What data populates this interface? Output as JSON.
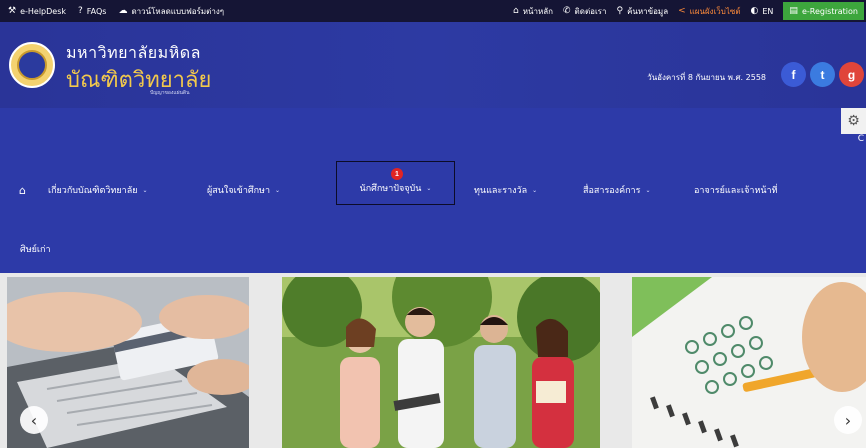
{
  "topbar": {
    "left": [
      {
        "icon": "helpdesk-icon",
        "glyph": "⚒",
        "label": "e-HelpDesk"
      },
      {
        "icon": "question-icon",
        "glyph": "?",
        "label": "FAQs"
      },
      {
        "icon": "cloud-download-icon",
        "glyph": "☁",
        "label": "ดาวน์โหลดแบบฟอร์มต่างๆ"
      }
    ],
    "right": [
      {
        "icon": "home-icon",
        "glyph": "⌂",
        "label": "หน้าหลัก"
      },
      {
        "icon": "phone-icon",
        "glyph": "✆",
        "label": "ติดต่อเรา"
      },
      {
        "icon": "search-icon",
        "glyph": "⚲",
        "label": "ค้นหาข้อมูล"
      },
      {
        "icon": "share-icon",
        "glyph": "<",
        "label": "แผนผังเว็บไซต์"
      },
      {
        "icon": "language-toggle-icon",
        "glyph": "◐",
        "label": "EN"
      }
    ],
    "register": {
      "icon": "register-icon",
      "glyph": "▤",
      "label": "e-Registration"
    }
  },
  "header": {
    "university_name": "มหาวิทยาลัยมหิดล",
    "graduate_name": "บัณฑิตวิทยาลัย",
    "motto": "ปัญญาของแผ่นดิน",
    "date": "วันอังคารที่ 8 กันยายน พ.ศ. 2558",
    "social": [
      {
        "icon": "facebook-icon",
        "glyph": "f"
      },
      {
        "icon": "twitter-icon",
        "glyph": "t"
      },
      {
        "icon": "google-plus-icon",
        "glyph": "g"
      }
    ]
  },
  "nav": {
    "home_glyph": "⌂",
    "items": [
      {
        "label": "เกี่ยวกับบัณฑิตวิทยาลัย",
        "caret": "⌄"
      },
      {
        "label": "ผู้สนใจเข้าศึกษา",
        "caret": "⌄"
      },
      {
        "label": "นักศึกษาปัจจุบัน",
        "caret": "⌄",
        "badge": "1"
      },
      {
        "label": "ทุนและรางวัล",
        "caret": "⌄"
      },
      {
        "label": "สื่อสารองค์การ",
        "caret": "⌄"
      },
      {
        "label": "อาจารย์และเจ้าหน้าที่"
      }
    ],
    "alumni": "ศิษย์เก่า",
    "settings_glyph": "⚙",
    "settings_letter": "C"
  },
  "carousel": {
    "prev": "‹",
    "next": "›",
    "colors": {
      "slide_bg": "#e9e9e9"
    }
  },
  "colors": {
    "topbar": "#151535",
    "header": "#2a3498",
    "nav": "#2d3aa8",
    "accent_gold": "#f2c94c",
    "badge": "#e02424",
    "register": "#3da63d"
  }
}
